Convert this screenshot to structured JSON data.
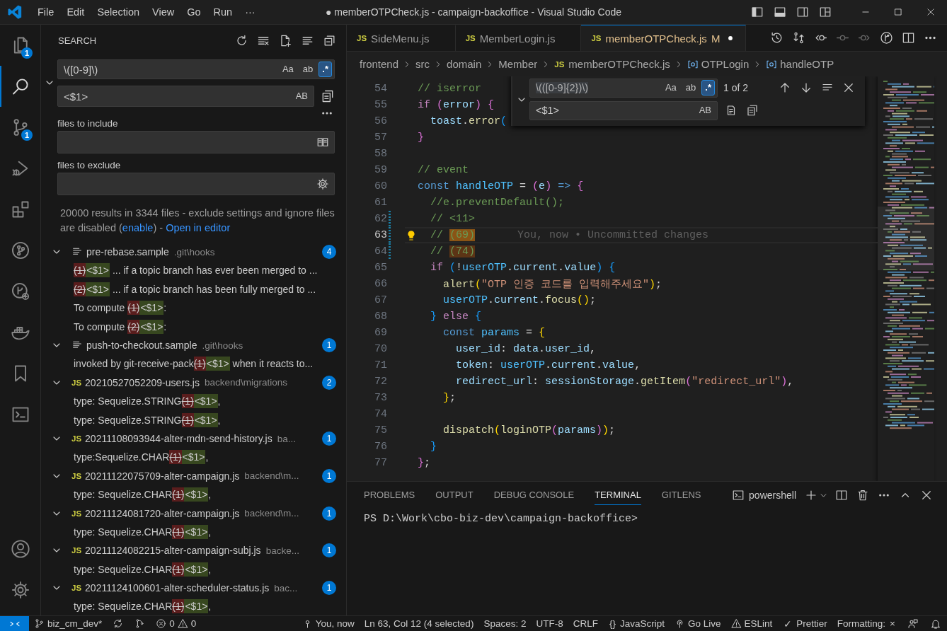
{
  "window": {
    "title": "● memberOTPCheck.js - campaign-backoffice - Visual Studio Code"
  },
  "menu": [
    "File",
    "Edit",
    "Selection",
    "View",
    "Go",
    "Run",
    "···"
  ],
  "activity_bar": {
    "items": [
      {
        "kind": "files",
        "badge": "1",
        "selected": false
      },
      {
        "kind": "search",
        "selected": true
      },
      {
        "kind": "scm",
        "badge": "1",
        "selected": false
      },
      {
        "kind": "debug",
        "selected": false
      },
      {
        "kind": "extensions",
        "selected": false
      },
      {
        "kind": "git-graph",
        "selected": false
      },
      {
        "kind": "gitlens",
        "selected": false
      },
      {
        "kind": "docker",
        "selected": false
      },
      {
        "kind": "bookmarks",
        "selected": false
      },
      {
        "kind": "terminal",
        "selected": false
      }
    ],
    "bottom": [
      {
        "kind": "account"
      },
      {
        "kind": "settings"
      }
    ]
  },
  "search": {
    "title": "SEARCH",
    "query": {
      "value": "\\([0-9]\\)",
      "options": [
        {
          "label": "Aa",
          "on": false
        },
        {
          "label": "ab",
          "on": false
        },
        {
          "label": ".*",
          "on": true
        }
      ]
    },
    "replace": {
      "value": "<$1>",
      "options": [
        {
          "label": "AB",
          "on": false
        }
      ]
    },
    "include": {
      "label": "files to include"
    },
    "exclude": {
      "label": "files to exclude"
    },
    "message": [
      {
        "text": "20000 results in 3344 files - exclude settings and ignore files are disabled ("
      },
      {
        "link": "enable"
      },
      {
        "text": ") - "
      },
      {
        "link": "Open in editor"
      }
    ],
    "results": [
      {
        "kind": "text",
        "name": "pre-rebase.sample",
        "path": ".git\\hooks",
        "count": "4",
        "expanded": true,
        "matches": [
          {
            "removed": "(1)",
            "added": "<$1>",
            "after": " ... if a topic branch has ever been merged to ..."
          },
          {
            "removed": "(2)",
            "added": "<$1>",
            "after": " ... if a topic branch has been fully merged to ..."
          },
          {
            "before": "To compute ",
            "removed": "(1)",
            "added": "<$1>",
            "after": ":"
          },
          {
            "before": "To compute ",
            "removed": "(2)",
            "added": "<$1>",
            "after": ":"
          }
        ]
      },
      {
        "kind": "text",
        "name": "push-to-checkout.sample",
        "path": ".git\\hooks",
        "count": "1",
        "expanded": true,
        "matches": [
          {
            "before": "invoked by git-receive-pack",
            "removed": "(1)",
            "added": "<$1>",
            "after": " when it reacts to..."
          }
        ]
      },
      {
        "kind": "js",
        "icon": "JS",
        "name": "20210527052209-users.js",
        "path": "backend\\migrations",
        "count": "2",
        "expanded": true,
        "matches": [
          {
            "before": "type: Sequelize.STRING",
            "removed": "(1)",
            "added": "<$1>",
            "after": ","
          },
          {
            "before": "type: Sequelize.STRING",
            "removed": "(1)",
            "added": "<$1>",
            "after": ","
          }
        ]
      },
      {
        "kind": "js",
        "icon": "JS",
        "name": "20211108093944-alter-mdn-send-history.js",
        "path": "ba...",
        "count": "1",
        "expanded": true,
        "matches": [
          {
            "before": "type:Sequelize.CHAR",
            "removed": "(1)",
            "added": "<$1>",
            "after": ","
          }
        ]
      },
      {
        "kind": "js",
        "icon": "JS",
        "name": "20211122075709-alter-campaign.js",
        "path": "backend\\m...",
        "count": "1",
        "expanded": true,
        "matches": [
          {
            "before": "type: Sequelize.CHAR",
            "removed": "(1)",
            "added": "<$1>",
            "after": ","
          }
        ]
      },
      {
        "kind": "js",
        "icon": "JS",
        "name": "20211124081720-alter-campaign.js",
        "path": "backend\\m...",
        "count": "1",
        "expanded": true,
        "matches": [
          {
            "before": "type: Sequelize.CHAR",
            "removed": "(1)",
            "added": "<$1>",
            "after": ","
          }
        ]
      },
      {
        "kind": "js",
        "icon": "JS",
        "name": "20211124082215-alter-campaign-subj.js",
        "path": "backe...",
        "count": "1",
        "expanded": true,
        "matches": [
          {
            "before": "type: Sequelize.CHAR",
            "removed": "(1)",
            "added": "<$1>",
            "after": ","
          }
        ]
      },
      {
        "kind": "js",
        "icon": "JS",
        "name": "20211124100601-alter-scheduler-status.js",
        "path": "bac...",
        "count": "1",
        "expanded": true,
        "matches": [
          {
            "before": "type: Sequelize.CHAR",
            "removed": "(1)",
            "added": "<$1>",
            "after": ","
          }
        ]
      }
    ]
  },
  "editor": {
    "tabs": [
      {
        "icon": "JS",
        "label": "SideMenu.js",
        "selected": false,
        "modified": false,
        "dirty": false
      },
      {
        "icon": "JS",
        "label": "MemberLogin.js",
        "selected": false,
        "modified": false,
        "dirty": false
      },
      {
        "icon": "JS",
        "label": "memberOTPCheck.js",
        "decoration": "M",
        "selected": true,
        "modified": true,
        "dirty": true
      }
    ],
    "breadcrumbs": [
      {
        "kind": "folder",
        "label": "frontend"
      },
      {
        "kind": "folder",
        "label": "src"
      },
      {
        "kind": "folder",
        "label": "domain"
      },
      {
        "kind": "folder",
        "label": "Member"
      },
      {
        "kind": "file",
        "icon": "JS",
        "label": "memberOTPCheck.js"
      },
      {
        "kind": "symbol",
        "label": "OTPLogin"
      },
      {
        "kind": "symbol",
        "label": "handleOTP"
      }
    ],
    "lines": [
      {
        "number": "54",
        "text": "  // iserror",
        "changed": false,
        "current": false
      },
      {
        "number": "55",
        "text": "  if (error) {",
        "changed": false,
        "current": false
      },
      {
        "number": "56",
        "text": "    toast.error(",
        "changed": false,
        "current": false
      },
      {
        "number": "57",
        "text": "  }",
        "changed": false,
        "current": false
      },
      {
        "number": "58",
        "changed": false,
        "current": false
      },
      {
        "number": "59",
        "text": "  // event",
        "changed": false,
        "current": false
      },
      {
        "number": "60",
        "text": "  const handleOTP = (e) => {",
        "changed": false,
        "current": false
      },
      {
        "number": "61",
        "text": "    //e.preventDefault();",
        "changed": false,
        "current": false
      },
      {
        "number": "62",
        "text": "    // <11>",
        "changed": true,
        "current": false
      },
      {
        "number": "63",
        "text": "    // ",
        "match": {
          "text": "(69)",
          "current": true
        },
        "changed": true,
        "current": true,
        "lightbulb": true,
        "blame": "You, now • Uncommitted changes"
      },
      {
        "number": "64",
        "text": "    // ",
        "match": {
          "text": "(74)",
          "current": false
        },
        "changed": true,
        "current": false
      },
      {
        "number": "65",
        "text": "    if (!userOTP.current.value) {",
        "changed": false,
        "current": false
      },
      {
        "number": "66",
        "text": "      alert(\"OTP 인증 코드를 입력해주세요\");",
        "changed": false,
        "current": false
      },
      {
        "number": "67",
        "text": "      userOTP.current.focus();",
        "changed": false,
        "current": false
      },
      {
        "number": "68",
        "text": "    } else {",
        "changed": false,
        "current": false
      },
      {
        "number": "69",
        "text": "      const params = {",
        "changed": false,
        "current": false
      },
      {
        "number": "70",
        "text": "        user_id: data.user_id,",
        "changed": false,
        "current": false
      },
      {
        "number": "71",
        "text": "        token: userOTP.current.value,",
        "changed": false,
        "current": false
      },
      {
        "number": "72",
        "text": "        redirect_url: sessionStorage.getItem(\"redirect_url\"),",
        "changed": false,
        "current": false
      },
      {
        "number": "73",
        "text": "      };",
        "changed": false,
        "current": false
      },
      {
        "number": "74",
        "changed": false,
        "current": false
      },
      {
        "number": "75",
        "text": "      dispatch(loginOTP(params));",
        "changed": false,
        "current": false
      },
      {
        "number": "76",
        "text": "    }",
        "changed": false,
        "current": false
      },
      {
        "number": "77",
        "text": "  };",
        "changed": false,
        "current": false
      }
    ],
    "find": {
      "value": "\\(([0-9]{2})\\)",
      "options": [
        {
          "label": "Aa",
          "on": false
        },
        {
          "label": "ab",
          "on": false
        },
        {
          "label": ".*",
          "on": true
        }
      ],
      "count": "1 of 2",
      "replace": {
        "value": "<$1>",
        "options": [
          {
            "label": "AB",
            "on": false
          }
        ]
      }
    }
  },
  "panel": {
    "tabs": [
      {
        "label": "PROBLEMS",
        "selected": false
      },
      {
        "label": "OUTPUT",
        "selected": false
      },
      {
        "label": "DEBUG CONSOLE",
        "selected": false
      },
      {
        "label": "TERMINAL",
        "selected": true
      },
      {
        "label": "GITLENS",
        "selected": false
      }
    ],
    "terminal_name": "powershell",
    "terminal_lines": [
      "PS D:\\Work\\cbo-biz-dev\\campaign-backoffice>"
    ]
  },
  "status_bar": {
    "branch": "biz_cm_dev*",
    "errors": "0",
    "warnings": "0",
    "items": [
      {
        "kind": "blame",
        "label": "You, now"
      },
      {
        "kind": "text",
        "label": "Ln 63, Col 12 (4 selected)"
      },
      {
        "kind": "text",
        "label": "Spaces: 2"
      },
      {
        "kind": "text",
        "label": "UTF-8"
      },
      {
        "kind": "text",
        "label": "CRLF"
      },
      {
        "kind": "glyph",
        "glyph": "{}",
        "label": "JavaScript"
      },
      {
        "kind": "live",
        "label": "Go Live"
      },
      {
        "kind": "eslint",
        "label": "ESLint"
      },
      {
        "kind": "glyph",
        "glyph": "✓",
        "label": "Prettier"
      },
      {
        "kind": "glyph-after",
        "label": "Formatting:",
        "glyph": "×"
      },
      {
        "kind": "feedback"
      },
      {
        "kind": "bell"
      }
    ]
  }
}
